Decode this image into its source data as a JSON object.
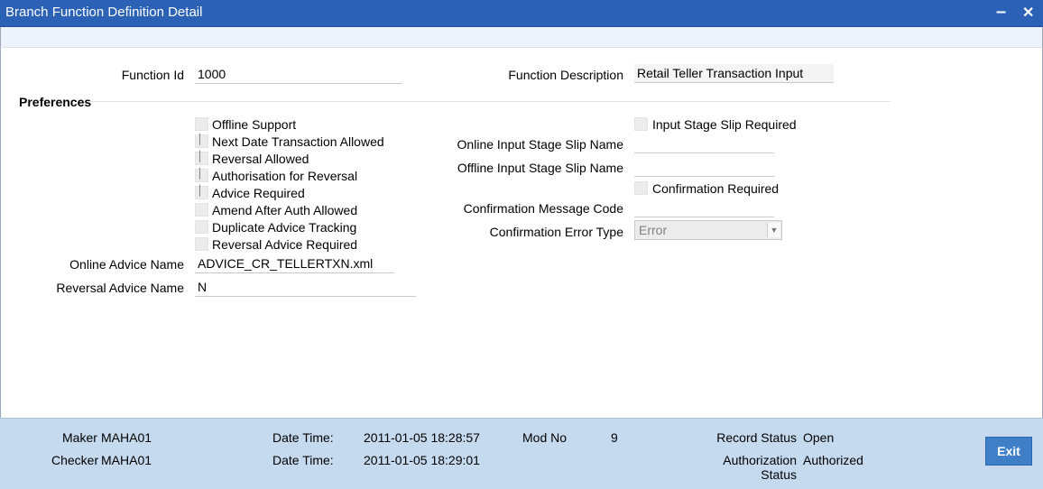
{
  "window": {
    "title": "Branch Function Definition Detail"
  },
  "form": {
    "function_id_label": "Function Id",
    "function_id_value": "1000",
    "function_desc_label": "Function Description",
    "function_desc_value": "Retail Teller Transaction Input",
    "preferences_label": "Preferences",
    "left_options": [
      {
        "label": "Offline Support",
        "checked": false
      },
      {
        "label": "Next Date Transaction Allowed",
        "checked": true
      },
      {
        "label": "Reversal Allowed",
        "checked": true
      },
      {
        "label": "Authorisation for Reversal",
        "checked": true
      },
      {
        "label": "Advice Required",
        "checked": true
      },
      {
        "label": "Amend After Auth Allowed",
        "checked": false
      },
      {
        "label": "Duplicate Advice Tracking",
        "checked": false
      },
      {
        "label": "Reversal Advice Required",
        "checked": false
      }
    ],
    "online_advice_label": "Online Advice Name",
    "online_advice_value": "ADVICE_CR_TELLERTXN.xml",
    "reversal_advice_label": "Reversal Advice Name",
    "reversal_advice_value": "N",
    "input_stage_slip_label": "Input Stage Slip Required",
    "online_slip_label": "Online Input Stage Slip Name",
    "online_slip_value": "",
    "offline_slip_label": "Offline Input Stage Slip Name",
    "offline_slip_value": "",
    "confirmation_required_label": "Confirmation Required",
    "confirmation_msg_label": "Confirmation Message Code",
    "confirmation_msg_value": "",
    "confirmation_error_label": "Confirmation Error Type",
    "confirmation_error_value": "Error"
  },
  "footer": {
    "maker_label": "Maker",
    "maker_value": "MAHA01",
    "checker_label": "Checker",
    "checker_value": "MAHA01",
    "date_time_label_1": "Date Time:",
    "date_time_value_1": "2011-01-05 18:28:57",
    "date_time_label_2": "Date Time:",
    "date_time_value_2": "2011-01-05 18:29:01",
    "mod_no_label": "Mod No",
    "mod_no_value": "9",
    "record_status_label": "Record Status",
    "record_status_value": "Open",
    "auth_status_label_1": "Authorization",
    "auth_status_label_2": "Status",
    "auth_status_value": "Authorized",
    "exit_label": "Exit"
  },
  "colors": {
    "titlebar": "#2b62b5",
    "footer": "#c5daee",
    "button": "#3f7fc8"
  }
}
